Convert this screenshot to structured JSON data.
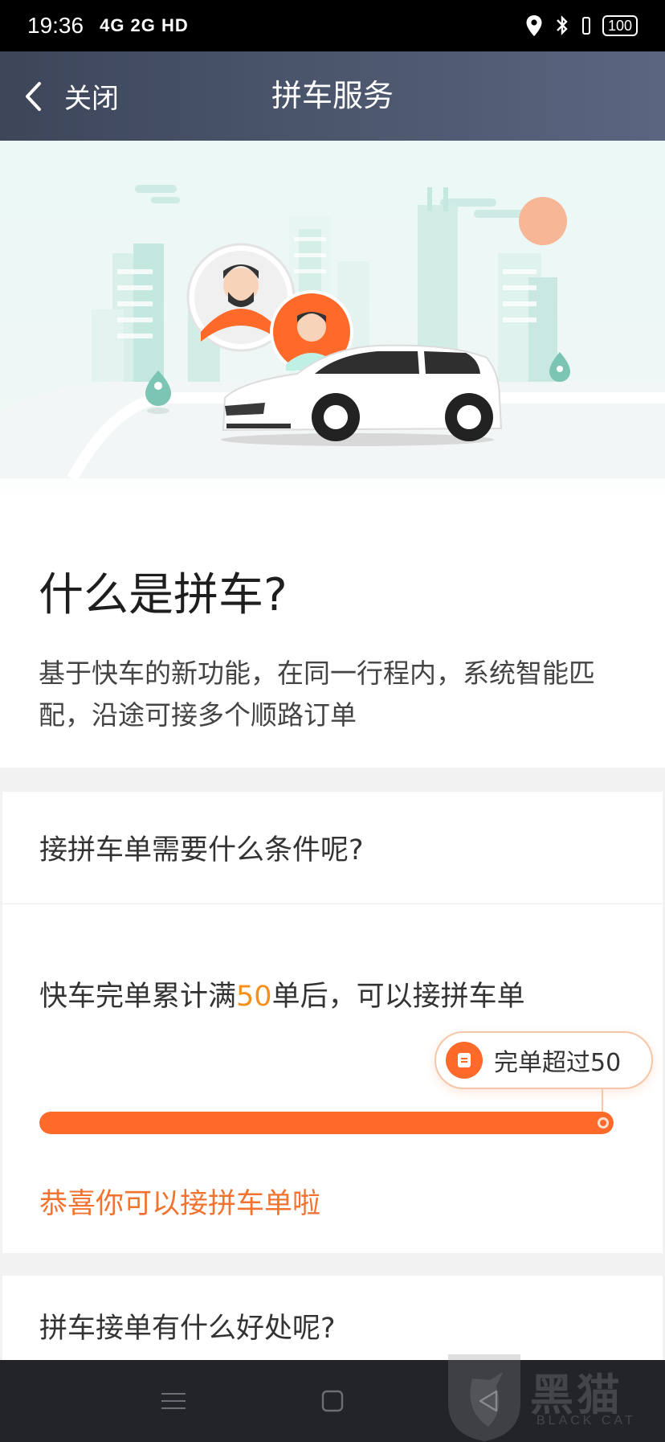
{
  "status_bar": {
    "time": "19:36",
    "network": "4G 2G HD",
    "battery": "100"
  },
  "nav": {
    "close_label": "关闭",
    "title": "拼车服务"
  },
  "intro": {
    "title": "什么是拼车?",
    "description": "基于快车的新功能，在同一行程内，系统智能匹配，沿途可接多个顺路订单"
  },
  "condition_card": {
    "title": "接拼车单需要什么条件呢?",
    "text_prefix": "快车完单累计满",
    "text_highlight": "50",
    "text_suffix": "单后，可以接拼车单",
    "bubble_label": "完单超过50",
    "progress": 1.0,
    "congrats": "恭喜你可以接拼车单啦"
  },
  "benefit_card": {
    "title": "拼车接单有什么好处呢?"
  },
  "watermark": {
    "text": "黑猫",
    "sub": "BLACK CAT"
  },
  "colors": {
    "accent": "#ff6a2a",
    "highlight": "#f5901e",
    "nav_bg": "#4a5368"
  }
}
